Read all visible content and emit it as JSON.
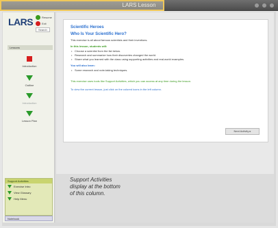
{
  "window": {
    "title": "LARS Lesson"
  },
  "sidebar": {
    "logo": "LARS",
    "status": {
      "resume_label": "Resume",
      "exit_label": "Exit",
      "search_label": "Search"
    },
    "section_label": "Lessons",
    "items": [
      {
        "label": "Introduction",
        "icon": "red-square-icon"
      },
      {
        "label": "Outline",
        "icon": "green-down-arrow-icon"
      },
      {
        "label": "Introduction",
        "icon": "green-down-arrow-icon",
        "dim": true
      },
      {
        "label": "Lesson Plan",
        "icon": "green-down-arrow-icon"
      }
    ],
    "support": {
      "header": "Support Activities",
      "items": [
        "Exercise Intro",
        "View Glossary",
        "Help Menu"
      ]
    },
    "notebook_label": "Notebook"
  },
  "content": {
    "title": "Scientific Heroes",
    "subtitle": "Who Is Your Scientific Hero?",
    "intro": "This exercise is all about famous scientists and their inventions.",
    "goals_heading": "In this lesson, students will:",
    "goals": [
      "Choose a scientist from the list below.",
      "Research and summarize how their discoveries changed the world.",
      "Share what you learned with the class using supporting activities and real-world examples."
    ],
    "also_heading": "You will also learn:",
    "also": [
      "Some research and note-taking techniques."
    ],
    "note_green": "This exercise uses tools like Support Activities, which you can access at any time during the lesson.",
    "note_blue": "To view the current lesson, just click on the colored icons in the left column.",
    "next_label": "Next Activity ▸"
  },
  "annotation": {
    "lines": [
      "Support Activities",
      "display at the bottom",
      "of this column."
    ]
  },
  "colors": {
    "accent_blue": "#2a6fcf",
    "accent_green": "#3a9a1e",
    "alert_red": "#d61e1e"
  }
}
